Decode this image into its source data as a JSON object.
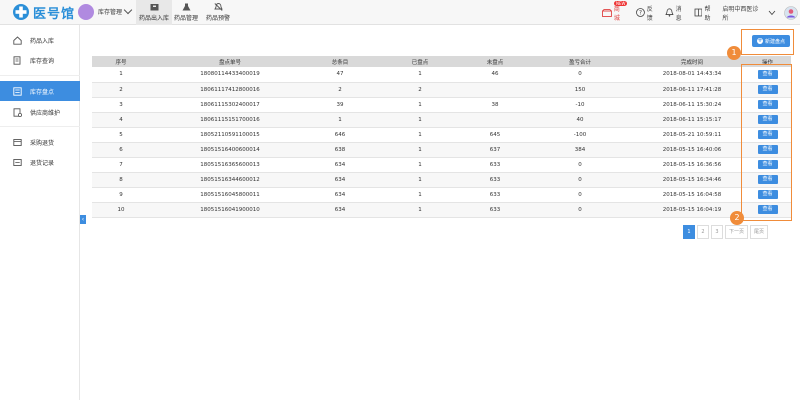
{
  "app": {
    "name": "医号馆"
  },
  "topbar": {
    "menu_label": "库存管理",
    "tabs": [
      {
        "label": "药品出入库",
        "icon": "box-icon"
      },
      {
        "label": "药品管理",
        "icon": "flask-icon"
      },
      {
        "label": "药品预警",
        "icon": "bell-off-icon"
      }
    ],
    "shop_label": "商城",
    "hot_badge": "NEW",
    "feedback_label": "反馈",
    "messages_label": "消息",
    "help_label": "帮助",
    "clinic_name": "启明中西医诊所"
  },
  "sidebar": {
    "items": [
      {
        "label": "药品入库",
        "icon": "home-icon"
      },
      {
        "label": "库存查询",
        "icon": "search-doc-icon"
      },
      {
        "label": "库存盘点",
        "icon": "inventory-icon"
      },
      {
        "label": "供应商维护",
        "icon": "supplier-icon"
      },
      {
        "label": "采购退货",
        "icon": "return-icon"
      },
      {
        "label": "退货记录",
        "icon": "record-icon"
      }
    ],
    "collapse_glyph": "‹"
  },
  "new_button": {
    "label": "新建盘点",
    "plus": "+"
  },
  "table": {
    "columns": [
      "序号",
      "盘点单号",
      "总条目",
      "已盘点",
      "未盘点",
      "盈亏合计",
      "完成时间",
      "操作"
    ],
    "action_label": "查看",
    "rows": [
      [
        "1",
        "18080114433400019",
        "47",
        "1",
        "46",
        "0",
        "2018-08-01 14:43:34"
      ],
      [
        "2",
        "18061117412800016",
        "2",
        "2",
        "",
        "150",
        "2018-06-11 17:41:28"
      ],
      [
        "3",
        "18061115302400017",
        "39",
        "1",
        "38",
        "-10",
        "2018-06-11 15:30:24"
      ],
      [
        "4",
        "18061115151700016",
        "1",
        "1",
        "",
        "40",
        "2018-06-11 15:15:17"
      ],
      [
        "5",
        "18052110591100015",
        "646",
        "1",
        "645",
        "-100",
        "2018-05-21 10:59:11"
      ],
      [
        "6",
        "18051516400600014",
        "638",
        "1",
        "637",
        "384",
        "2018-05-15 16:40:06"
      ],
      [
        "7",
        "18051516365600013",
        "634",
        "1",
        "633",
        "0",
        "2018-05-15 16:36:56"
      ],
      [
        "8",
        "18051516344600012",
        "634",
        "1",
        "633",
        "0",
        "2018-05-15 16:34:46"
      ],
      [
        "9",
        "18051516045800011",
        "634",
        "1",
        "633",
        "0",
        "2018-05-15 16:04:58"
      ],
      [
        "10",
        "18051516041900010",
        "634",
        "1",
        "633",
        "0",
        "2018-05-15 16:04:19"
      ]
    ]
  },
  "annotations": [
    "1",
    "2"
  ],
  "pagination": {
    "pages": [
      "1",
      "2",
      "3"
    ],
    "next": "下一页",
    "last": "尾页"
  },
  "colors": {
    "accent": "#3d8de0",
    "annotation": "#f08c3a"
  }
}
